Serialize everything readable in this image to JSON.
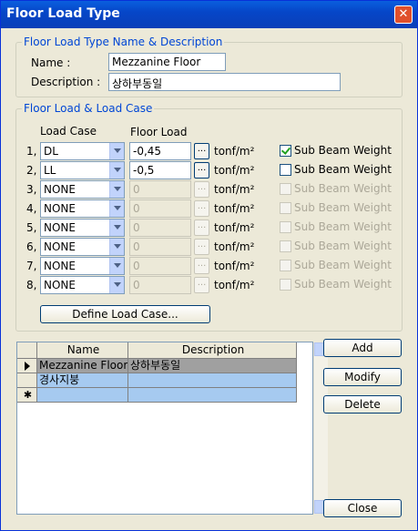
{
  "window": {
    "title": "Floor Load Type",
    "close_glyph": "✕"
  },
  "name_section": {
    "legend": "Floor Load Type Name & Description",
    "name_label": "Name :",
    "name_value": "Mezzanine Floor",
    "desc_label": "Description :",
    "desc_value": "상하부동일"
  },
  "load_section": {
    "legend": "Floor Load & Load Case",
    "col_load_case": "Load Case",
    "col_floor_load": "Floor Load",
    "unit": "tonf/m²",
    "ellipsis": "...",
    "sub_beam_label": "Sub Beam Weight",
    "rows": [
      {
        "num": "1,",
        "case": "DL",
        "load": "-0,45",
        "enabled": true,
        "sub_beam": true
      },
      {
        "num": "2,",
        "case": "LL",
        "load": "-0,5",
        "enabled": true,
        "sub_beam": false
      },
      {
        "num": "3,",
        "case": "NONE",
        "load": "0",
        "enabled": false,
        "sub_beam": false
      },
      {
        "num": "4,",
        "case": "NONE",
        "load": "0",
        "enabled": false,
        "sub_beam": false
      },
      {
        "num": "5,",
        "case": "NONE",
        "load": "0",
        "enabled": false,
        "sub_beam": false
      },
      {
        "num": "6,",
        "case": "NONE",
        "load": "0",
        "enabled": false,
        "sub_beam": false
      },
      {
        "num": "7,",
        "case": "NONE",
        "load": "0",
        "enabled": false,
        "sub_beam": false
      },
      {
        "num": "8,",
        "case": "NONE",
        "load": "0",
        "enabled": false,
        "sub_beam": false
      }
    ],
    "define_button": "Define Load Case..."
  },
  "grid": {
    "col_name": "Name",
    "col_desc": "Description",
    "new_row_marker": "✱",
    "rows": [
      {
        "name": "Mezzanine Floor",
        "desc": "상하부동일",
        "current": true
      },
      {
        "name": "경사지붕",
        "desc": "",
        "current": false
      }
    ]
  },
  "buttons": {
    "add": "Add",
    "modify": "Modify",
    "delete": "Delete",
    "close": "Close"
  },
  "colors": {
    "accent": "#0046d5",
    "titlebar": "#0646c8",
    "selected_row": "#a6caf0"
  }
}
